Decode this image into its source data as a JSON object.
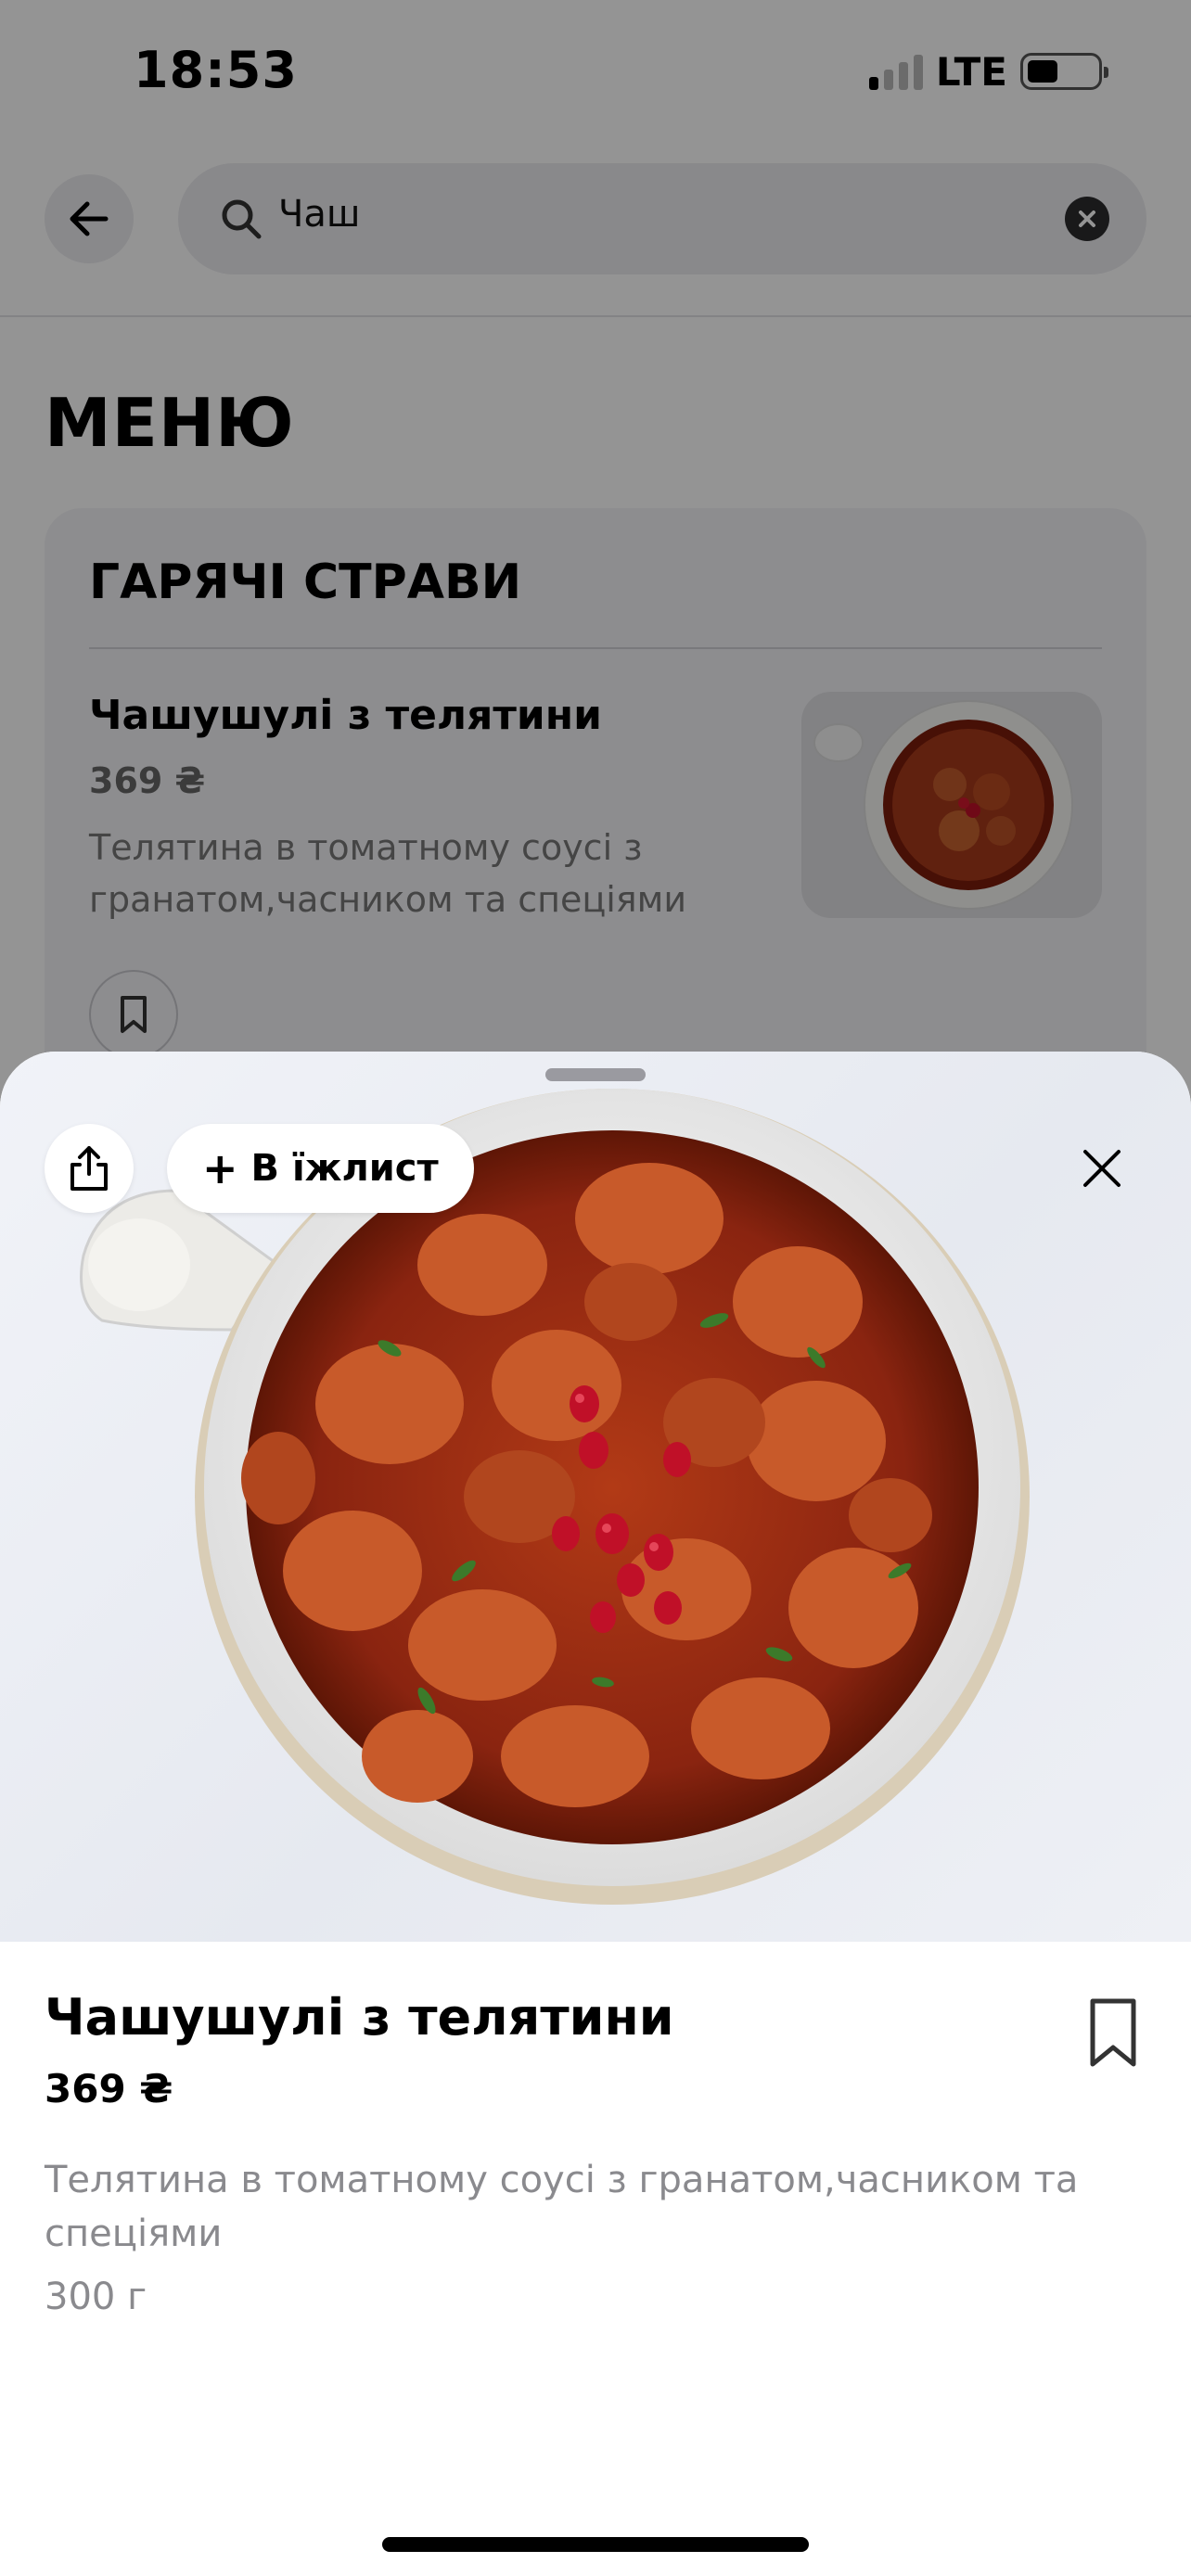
{
  "status_bar": {
    "time": "18:53",
    "network": "LTE",
    "signal_bars_active": 1,
    "signal_bars_total": 4,
    "battery_level": 0.35
  },
  "search": {
    "query": "Чаш",
    "back_icon": "arrow-left-icon",
    "search_icon": "magnifier-icon",
    "clear_icon": "close-circle-icon"
  },
  "menu": {
    "title": "МЕНЮ",
    "category": {
      "title": "ГАРЯЧІ СТРАВИ",
      "items": [
        {
          "name": "Чашушулі з телятини",
          "price": "369 ₴",
          "description": "Телятина в томатному соусі з гранатом,часником та спеціями",
          "bookmark_icon": "bookmark-icon"
        }
      ]
    }
  },
  "sheet": {
    "share_icon": "share-icon",
    "add_button_label": "В їжлист",
    "add_icon": "plus-icon",
    "close_icon": "close-icon",
    "dish": {
      "name": "Чашушулі з телятини",
      "price": "369 ₴",
      "description": "Телятина в томатному соусі з гранатом,часником та спеціями",
      "weight": "300 г",
      "bookmark_icon": "bookmark-icon"
    }
  },
  "colors": {
    "accent_text": "#000000",
    "secondary_text": "#8a8a8e",
    "sauce": "#9e2a12",
    "pomegranate": "#c01028"
  }
}
